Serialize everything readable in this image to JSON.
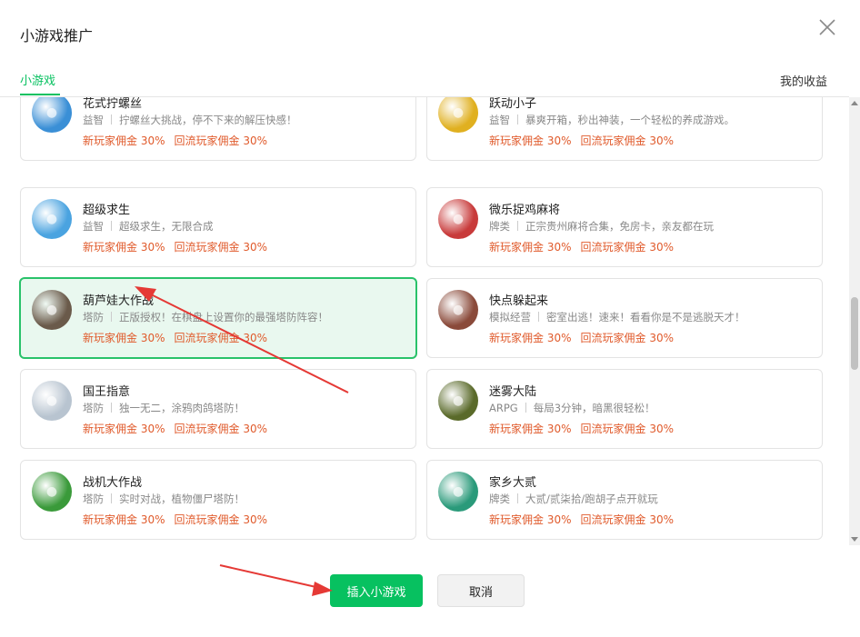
{
  "dialog": {
    "title": "小游戏推广",
    "tab_label": "小游戏",
    "income_label": "我的收益"
  },
  "games": [
    {
      "name": "花式拧螺丝",
      "category": "益智",
      "desc": "拧螺丝大挑战，停不下来的解压快感！",
      "new_comm": "新玩家佣金 30%",
      "return_comm": "回流玩家佣金 30%",
      "avatar_color": "#3a8fd6",
      "avatar_icon": "screw-icon",
      "selected": false
    },
    {
      "name": "跃动小子",
      "category": "益智",
      "desc": "暴爽开箱，秒出神装，一个轻松的养成游戏。",
      "new_comm": "新玩家佣金 30%",
      "return_comm": "回流玩家佣金 30%",
      "avatar_color": "#e0b020",
      "avatar_icon": "knight-icon",
      "selected": false
    },
    {
      "name": "超级求生",
      "category": "益智",
      "desc": "超级求生，无限合成",
      "new_comm": "新玩家佣金 30%",
      "return_comm": "回流玩家佣金 30%",
      "avatar_color": "#4aa3e0",
      "avatar_icon": "duck-icon",
      "selected": false
    },
    {
      "name": "微乐捉鸡麻将",
      "category": "牌类",
      "desc": "正宗贵州麻将合集，免房卡，亲友都在玩",
      "new_comm": "新玩家佣金 30%",
      "return_comm": "回流玩家佣金 30%",
      "avatar_color": "#c83a3a",
      "avatar_icon": "mahjong-icon",
      "selected": false
    },
    {
      "name": "葫芦娃大作战",
      "category": "塔防",
      "desc": "正版授权！在棋盘上设置你的最强塔防阵容！",
      "new_comm": "新玩家佣金 30%",
      "return_comm": "回流玩家佣金 30%",
      "avatar_color": "#6a5a4a",
      "avatar_icon": "gourd-boy-icon",
      "selected": true
    },
    {
      "name": "快点躲起来",
      "category": "模拟经营",
      "desc": "密室出逃！速来！看看你是不是逃脱天才！",
      "new_comm": "新玩家佣金 30%",
      "return_comm": "回流玩家佣金 30%",
      "avatar_color": "#8a4a3a",
      "avatar_icon": "girl-icon",
      "selected": false
    },
    {
      "name": "国王指意",
      "category": "塔防",
      "desc": "独一无二，涂鸦肉鸽塔防！",
      "new_comm": "新玩家佣金 30%",
      "return_comm": "回流玩家佣金 30%",
      "avatar_color": "#b8c4d0",
      "avatar_icon": "king-icon",
      "selected": false
    },
    {
      "name": "迷雾大陆",
      "category": "ARPG",
      "desc": "每局3分钟，暗黑很轻松！",
      "new_comm": "新玩家佣金 30%",
      "return_comm": "回流玩家佣金 30%",
      "avatar_color": "#5a6a2a",
      "avatar_icon": "fox-warrior-icon",
      "selected": false
    },
    {
      "name": "战机大作战",
      "category": "塔防",
      "desc": "实时对战，植物僵尸塔防！",
      "new_comm": "新玩家佣金 30%",
      "return_comm": "回流玩家佣金 30%",
      "avatar_color": "#3a9a3a",
      "avatar_icon": "zombie-icon",
      "selected": false
    },
    {
      "name": "家乡大贰",
      "category": "牌类",
      "desc": "大贰/贰柒拾/跑胡子点开就玩",
      "new_comm": "新玩家佣金 30%",
      "return_comm": "回流玩家佣金 30%",
      "avatar_color": "#2a9a7a",
      "avatar_icon": "cards-icon",
      "selected": false
    }
  ],
  "footer": {
    "insert_label": "插入小游戏",
    "cancel_label": "取消"
  },
  "accent_color": "#07c160",
  "commission_color": "#e05a2b",
  "annotation_arrow_color": "#e53935"
}
